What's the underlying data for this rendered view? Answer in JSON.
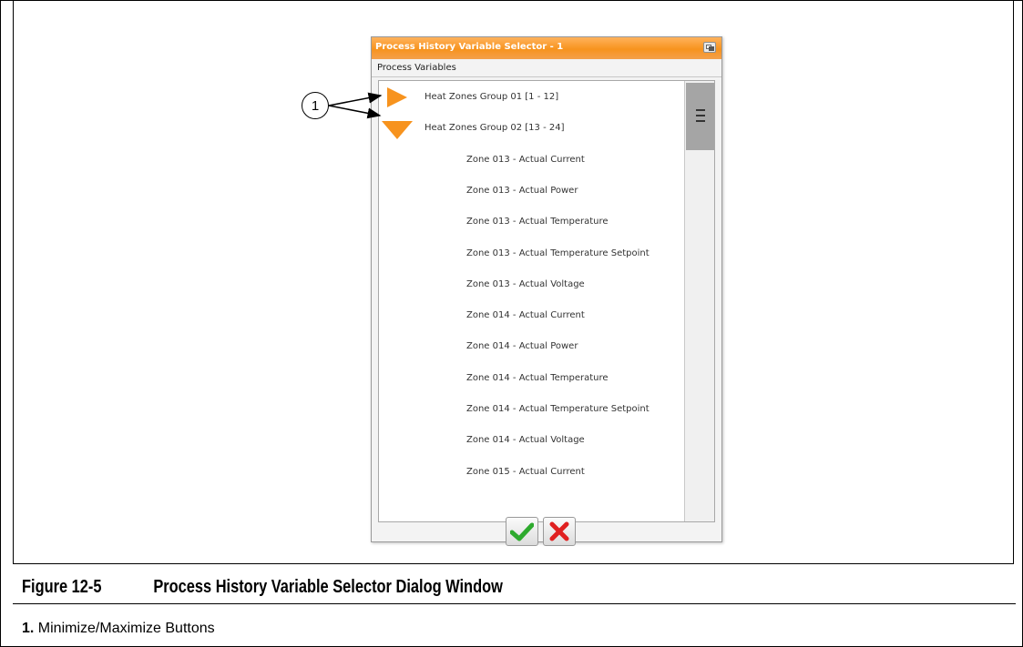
{
  "dialog": {
    "title": "Process History Variable Selector - 1",
    "window_button_icon": "minimize-maximize-icon",
    "section_label": "Process Variables",
    "groups": [
      {
        "label": "Heat Zones Group 01 [1 - 12]",
        "expanded": false,
        "expander_icon": "triangle-right-icon"
      },
      {
        "label": "Heat Zones Group 02 [13 - 24]",
        "expanded": true,
        "expander_icon": "triangle-down-icon"
      }
    ],
    "children": [
      "Zone 013 - Actual Current",
      "Zone 013 - Actual Power",
      "Zone 013 - Actual Temperature",
      "Zone 013 - Actual Temperature Setpoint",
      "Zone 013 - Actual Voltage",
      "Zone 014 - Actual Current",
      "Zone 014 - Actual Power",
      "Zone 014 - Actual Temperature",
      "Zone 014 - Actual Temperature Setpoint",
      "Zone 014 - Actual Voltage",
      "Zone 015 - Actual Current"
    ],
    "ok_icon": "checkmark-icon",
    "cancel_icon": "x-icon"
  },
  "colors": {
    "accent_orange": "#f7931e",
    "ok_green": "#2eaa2e",
    "cancel_red": "#e02020"
  },
  "callout": {
    "number": "1"
  },
  "caption": {
    "figure_number": "Figure 12-5",
    "figure_title": "Process History Variable Selector Dialog Window"
  },
  "legend": {
    "item_number": "1.",
    "item_text": "Minimize/Maximize Buttons"
  }
}
